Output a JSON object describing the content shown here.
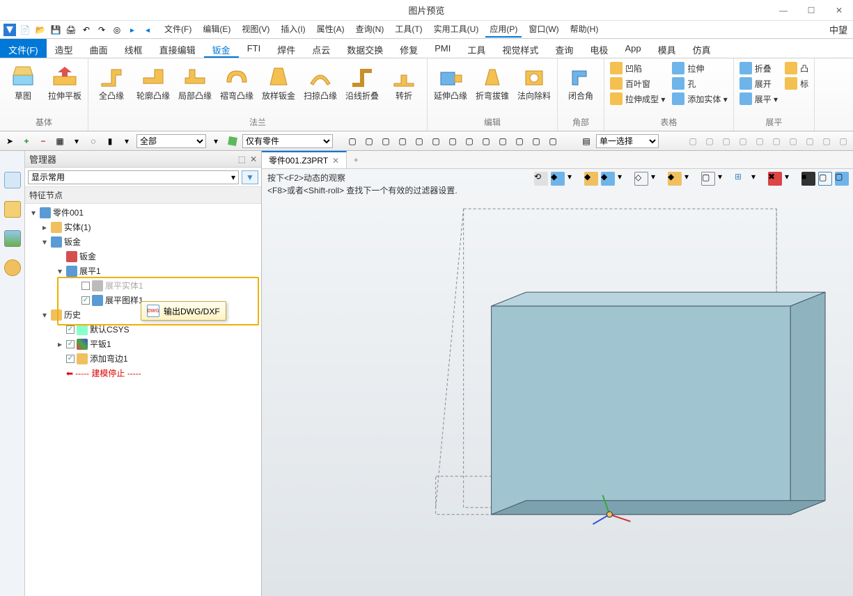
{
  "window": {
    "title": "图片预览",
    "lang": "中望"
  },
  "menus": [
    "文件(F)",
    "编辑(E)",
    "视图(V)",
    "插入(I)",
    "属性(A)",
    "查询(N)",
    "工具(T)",
    "实用工具(U)",
    "应用(P)",
    "窗口(W)",
    "帮助(H)"
  ],
  "ribbon_tabs": [
    "文件(F)",
    "造型",
    "曲面",
    "线框",
    "直接编辑",
    "钣金",
    "FTI",
    "焊件",
    "点云",
    "数据交换",
    "修复",
    "PMI",
    "工具",
    "视觉样式",
    "查询",
    "电极",
    "App",
    "模具",
    "仿真"
  ],
  "ribbon_active": "钣金",
  "ribbon": {
    "groups": [
      {
        "label": "基体",
        "items": [
          "草图",
          "拉伸平板"
        ]
      },
      {
        "label": "法兰",
        "items": [
          "全凸缘",
          "轮廓凸缘",
          "局部凸缘",
          "褶弯凸缘",
          "放样钣金",
          "扫掠凸缘",
          "沿线折叠",
          "转折"
        ]
      },
      {
        "label": "编辑",
        "items": [
          "延伸凸缘",
          "折弯拔锥",
          "法向除料"
        ]
      },
      {
        "label": "角部",
        "items": [
          "闭合角"
        ]
      },
      {
        "label": "表格",
        "small": [
          [
            "凹陷",
            "拉伸"
          ],
          [
            "百叶窗",
            "孔"
          ],
          [
            "拉伸成型 ▾",
            "添加实体 ▾"
          ]
        ]
      },
      {
        "label": "展平",
        "small": [
          [
            "折叠",
            "凸"
          ],
          [
            "展开",
            "标"
          ],
          [
            "展平 ▾",
            ""
          ]
        ]
      }
    ]
  },
  "toolbar2": {
    "filter1": "全部",
    "filter2": "仅有零件",
    "select_mode": "单一选择"
  },
  "manager": {
    "title": "管理器",
    "display_combo": "显示常用",
    "section": "特征节点",
    "tree": {
      "root": "零件001",
      "entity": "实体(1)",
      "sheet": "钣金",
      "sheet_child": "钣金",
      "flatten": "展平1",
      "flat_entity": "展平实体1",
      "flat_pattern": "展平图样1",
      "history": "历史",
      "csys": "默认CSYS",
      "flat_bend": "平钣1",
      "add_bend": "添加弯边1",
      "stop": "----- 建模停止 -----"
    },
    "context_menu": "输出DWG/DXF"
  },
  "document": {
    "tab": "零件001.Z3PRT",
    "hint1": "按下<F2>动态的观察",
    "hint2": "<F8>或者<Shift-roll> 查找下一个有效的过滤器设置."
  }
}
